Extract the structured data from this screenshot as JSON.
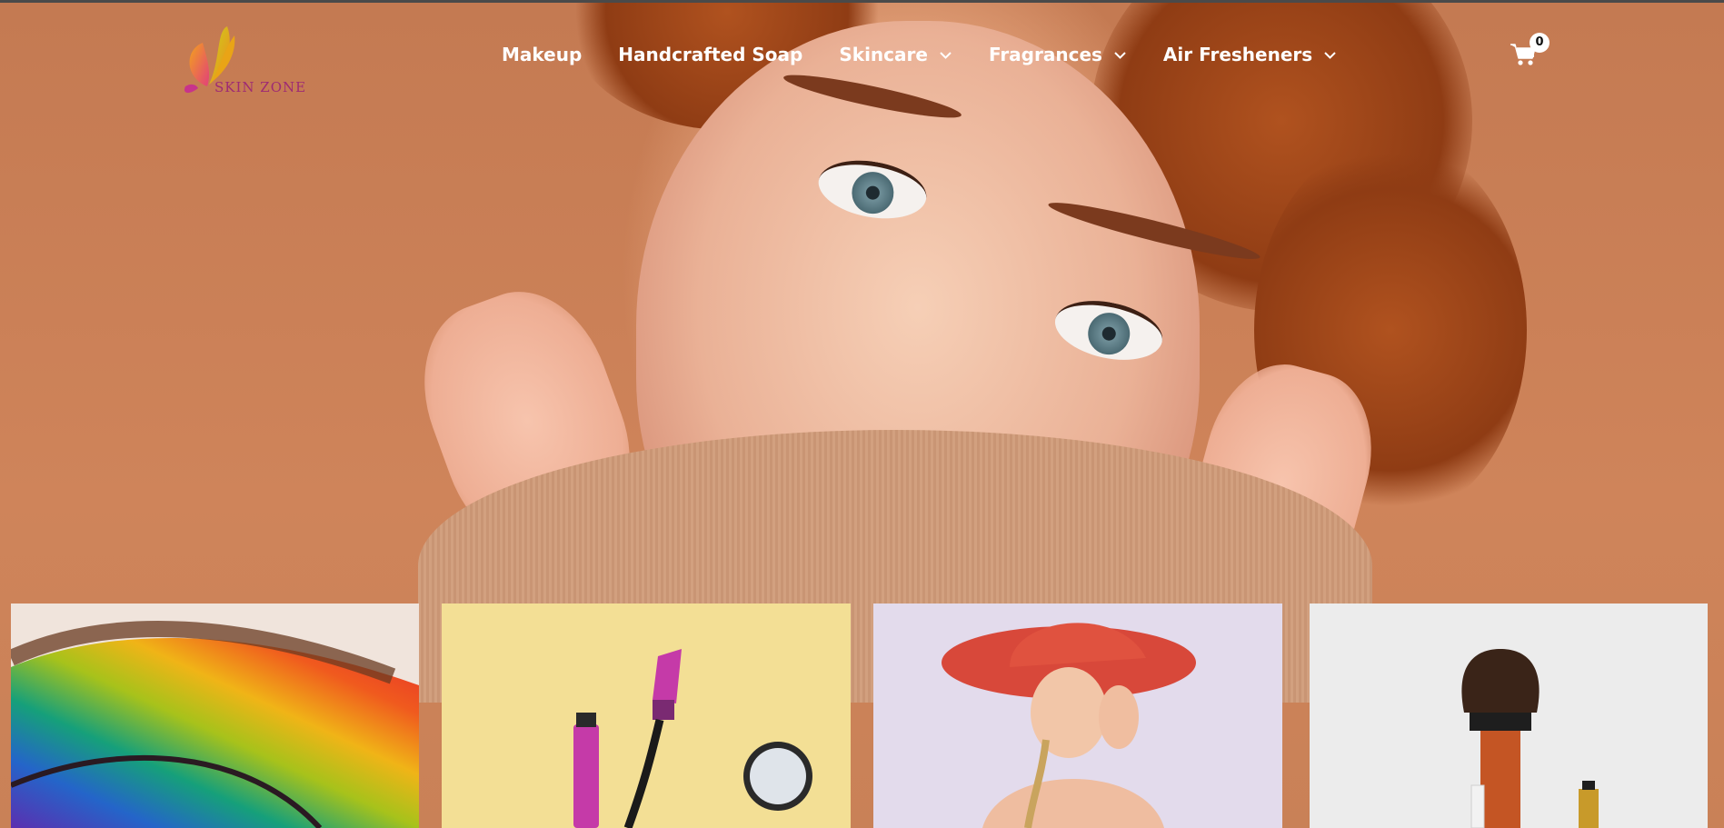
{
  "brand": {
    "logo_text": "SKIN ZONE"
  },
  "nav": {
    "items": [
      {
        "label": "Makeup",
        "has_dropdown": false
      },
      {
        "label": "Handcrafted Soap",
        "has_dropdown": false
      },
      {
        "label": "Skincare",
        "has_dropdown": true
      },
      {
        "label": "Fragrances",
        "has_dropdown": true
      },
      {
        "label": "Air Fresheners",
        "has_dropdown": true
      }
    ]
  },
  "cart": {
    "count": "0",
    "icon": "shopping-cart-icon"
  },
  "hero": {
    "image": "woman-portrait-hero"
  },
  "cards": [
    {
      "image": "rainbow-eyeshadow-image"
    },
    {
      "image": "mascara-product-image"
    },
    {
      "image": "woman-red-hat-image"
    },
    {
      "image": "makeup-brush-product-image"
    }
  ],
  "colors": {
    "nav_text": "#ffffff",
    "hero_bg": "#c47a52",
    "logo_text": "#9e2a74"
  }
}
